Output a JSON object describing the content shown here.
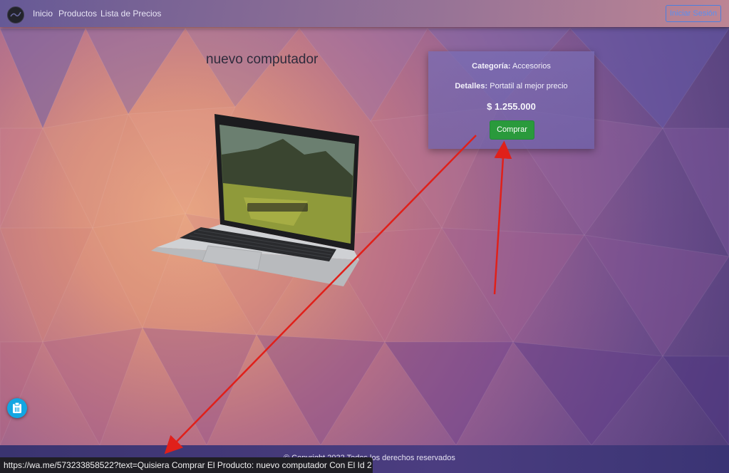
{
  "nav": {
    "links": [
      "Inicio",
      "Productos",
      "Lista de Precios"
    ],
    "login_label": "Iniciar Sesión"
  },
  "product": {
    "title": "nuevo computador",
    "category_label": "Categoría:",
    "category_value": "Accesorios",
    "details_label": "Detalles:",
    "details_value": "Portatil al mejor precio",
    "price": "$ 1.255.000",
    "buy_label": "Comprar"
  },
  "footer": {
    "text": "© Copyright 2022 Todos los derechos reservados"
  },
  "status_bar": {
    "url": "https://wa.me/573233858522?text=Quisiera Comprar El Producto: nuevo computador Con El Id 2"
  },
  "icons": {
    "logo": "brand-logo-icon",
    "fab": "clipboard-icon"
  },
  "colors": {
    "buy_button": "#2a9a3c",
    "login_border": "#4a7fe0",
    "arrow": "#e0201a"
  }
}
